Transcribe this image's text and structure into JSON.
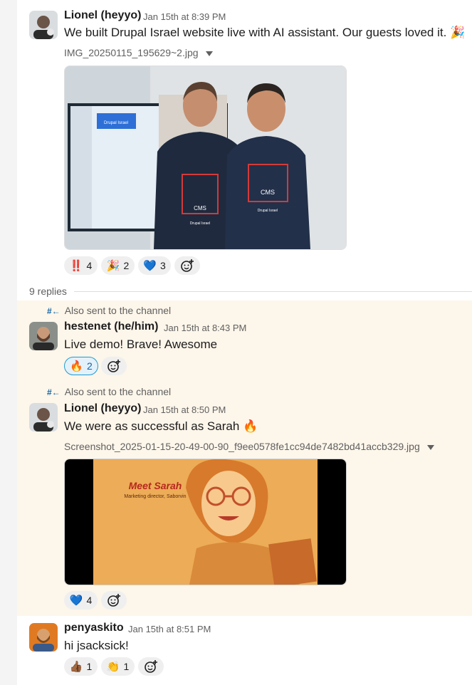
{
  "messages": [
    {
      "author": "Lionel (heyyo)",
      "time": "Jan 15th at 8:39 PM",
      "text": "We built Drupal Israel website live with AI assistant. Our guests loved it. 🎉",
      "attachment": "IMG_20250115_195629~2.jpg",
      "photo": {
        "screen_title": "Drupal Israel",
        "shirt_text": "CMS",
        "shirt_caption": "Drupal Israel"
      },
      "reactions": [
        {
          "emoji": "‼️",
          "count": "4"
        },
        {
          "emoji": "🎉",
          "count": "2"
        },
        {
          "emoji": "💙",
          "count": "3"
        }
      ]
    }
  ],
  "thread": {
    "replies_label": "9 replies",
    "also_sent": "Also sent to the channel",
    "replies": [
      {
        "author": "hestenet (he/him)",
        "time": "Jan 15th at 8:43 PM",
        "text": "Live demo! Brave! Awesome",
        "reactions": [
          {
            "emoji": "🔥",
            "count": "2",
            "selected": true
          }
        ]
      },
      {
        "author": "Lionel (heyyo)",
        "time": "Jan 15th at 8:50 PM",
        "text": "We were as successful as Sarah 🔥",
        "attachment": "Screenshot_2025-01-15-20-49-00-90_f9ee0578fe1cc94de7482bd41accb329.jpg",
        "photo": {
          "title": "Meet Sarah",
          "subtitle": "Marketing director, Saborvin"
        },
        "reactions": [
          {
            "emoji": "💙",
            "count": "4"
          }
        ]
      }
    ]
  },
  "last": {
    "author": "penyaskito",
    "time": "Jan 15th at 8:51 PM",
    "text": "hi jsacksick!",
    "reactions": [
      {
        "emoji": "👍🏾",
        "count": "1"
      },
      {
        "emoji": "👏",
        "count": "1"
      }
    ]
  },
  "icons": {
    "add_reaction": "add-reaction-icon",
    "file_menu": "chevron-down-icon",
    "shared": "hash-arrow-icon"
  },
  "colors": {
    "link": "#1264a3",
    "thread_bg": "#fdf6ea",
    "reaction_bg": "#efefef",
    "selected_border": "#1d9bd1"
  }
}
